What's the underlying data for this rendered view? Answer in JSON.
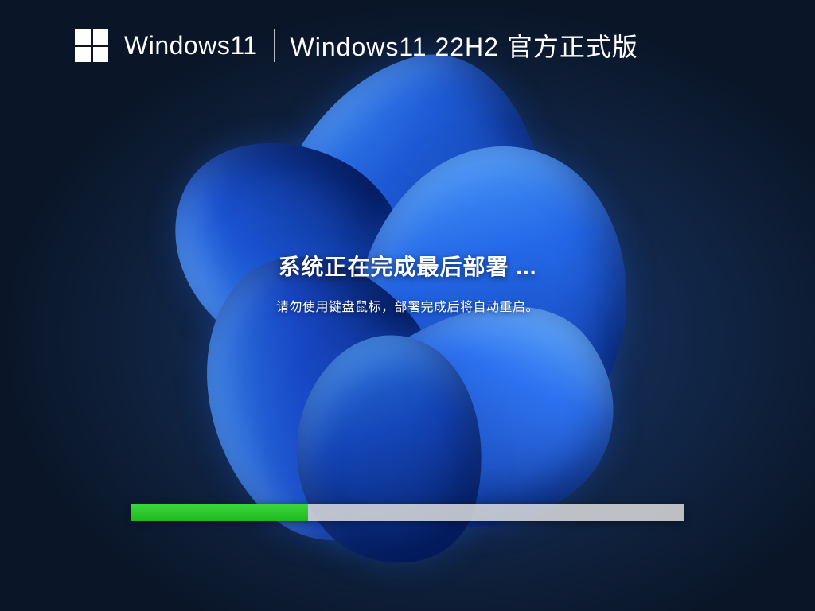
{
  "header": {
    "brand": "Windows11",
    "version": "Windows11 22H2 官方正式版"
  },
  "status": {
    "main_text": "系统正在完成最后部署 ...",
    "sub_text": "请勿使用键盘鼠标，部署完成后将自动重启。"
  },
  "progress": {
    "percent": 32
  },
  "colors": {
    "background": "#0a1628",
    "progress_fill": "#1db81d",
    "progress_track": "#dcdcdc",
    "text": "#ffffff"
  }
}
